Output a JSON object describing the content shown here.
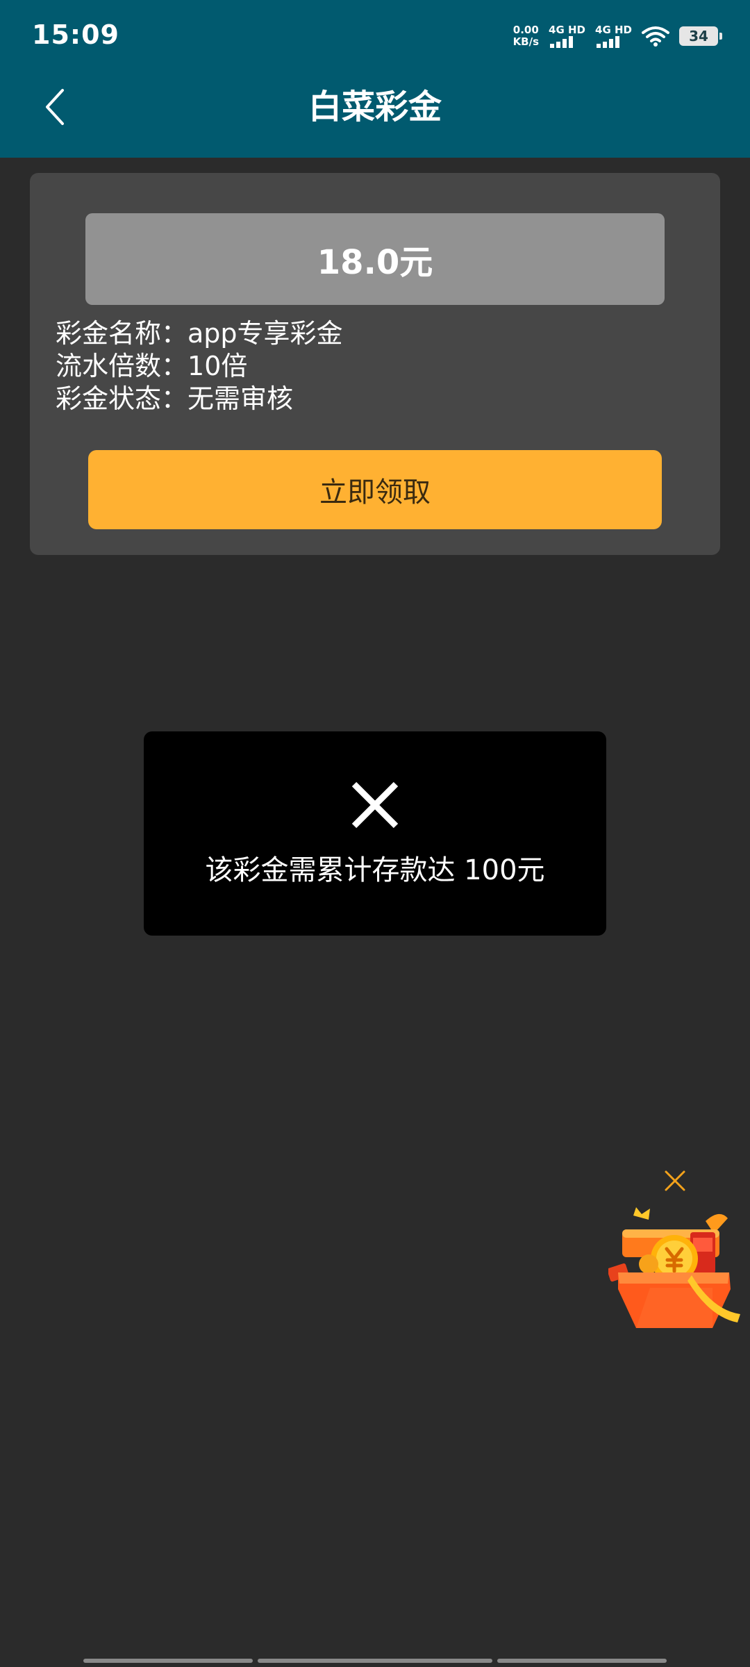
{
  "status_bar": {
    "time": "15:09",
    "net_speed_value": "0.00",
    "net_speed_unit": "KB/s",
    "signal1_label": "4G HD",
    "signal2_label": "4G HD",
    "battery": "34"
  },
  "header": {
    "title": "白菜彩金",
    "back_icon": "chevron-left-icon"
  },
  "bonus_card": {
    "amount": "18.0元",
    "rows": [
      {
        "label": "彩金名称：",
        "value": "app专享彩金"
      },
      {
        "label": "流水倍数：",
        "value": "10倍"
      },
      {
        "label": "彩金状态：",
        "value": "无需审核"
      }
    ],
    "claim_label": "立即领取"
  },
  "toast": {
    "icon": "close-icon",
    "message": "该彩金需累计存款达 100元"
  },
  "floating_widget": {
    "close_icon": "close-icon",
    "gift_icon": "gift-box-icon"
  },
  "colors": {
    "header_bg": "#015a6f",
    "page_bg": "#2b2b2b",
    "card_bg": "#474747",
    "amount_bg": "#929292",
    "accent_button": "#ffb132",
    "toast_bg": "#000000"
  }
}
